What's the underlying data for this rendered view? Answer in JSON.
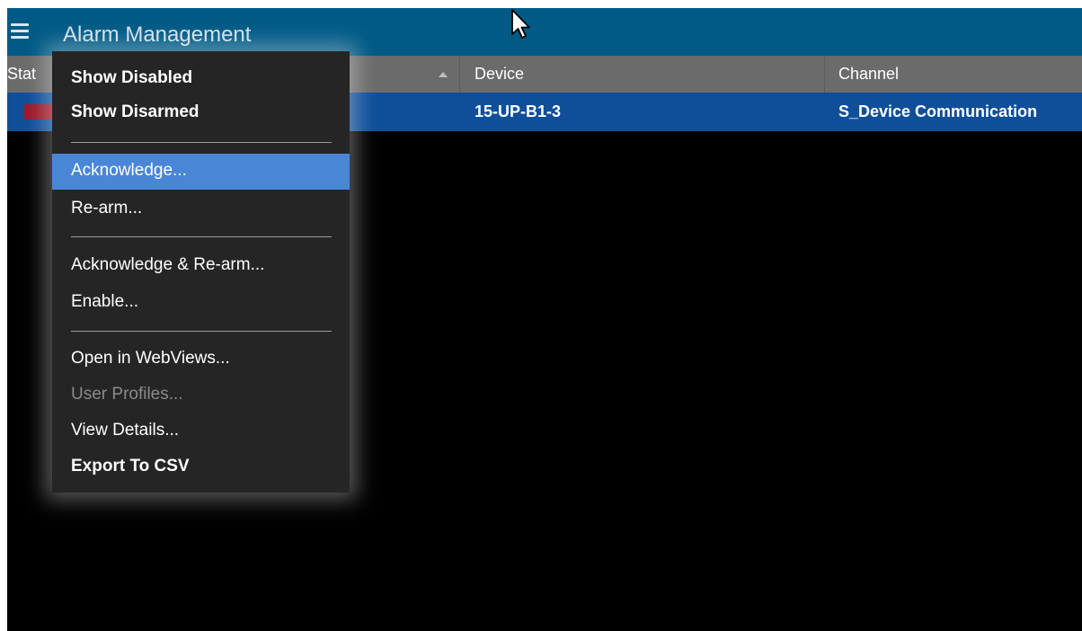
{
  "app": {
    "title": "Alarm Management"
  },
  "table": {
    "columns": [
      "Stat",
      "Device",
      "Channel"
    ],
    "rows": [
      {
        "status_color": "#9a1a2a",
        "device": "15-UP-B1-3",
        "channel": "S_Device Communication"
      }
    ]
  },
  "context_menu": {
    "items": [
      {
        "label": "Show Disabled",
        "style": "bold"
      },
      {
        "label": "Show Disarmed",
        "style": "bold"
      },
      {
        "label": "Acknowledge...",
        "style": "highlighted"
      },
      {
        "label": "Re-arm...",
        "style": "normal"
      },
      {
        "label": "Acknowledge & Re-arm...",
        "style": "normal"
      },
      {
        "label": "Enable...",
        "style": "normal"
      },
      {
        "label": "Open in WebViews...",
        "style": "normal"
      },
      {
        "label": "User Profiles...",
        "style": "disabled"
      },
      {
        "label": "View Details...",
        "style": "normal"
      },
      {
        "label": "Export To CSV",
        "style": "bold"
      }
    ]
  },
  "colors": {
    "titlebar": "#005a85",
    "header": "#6b6b6b",
    "selected_row": "#0f4f99",
    "menu_background": "#252526",
    "menu_highlight": "#4a86d6"
  },
  "icons": {
    "menu": "hamburger-icon",
    "sort": "sort-ascending-icon",
    "pointer": "mouse-cursor-icon"
  }
}
